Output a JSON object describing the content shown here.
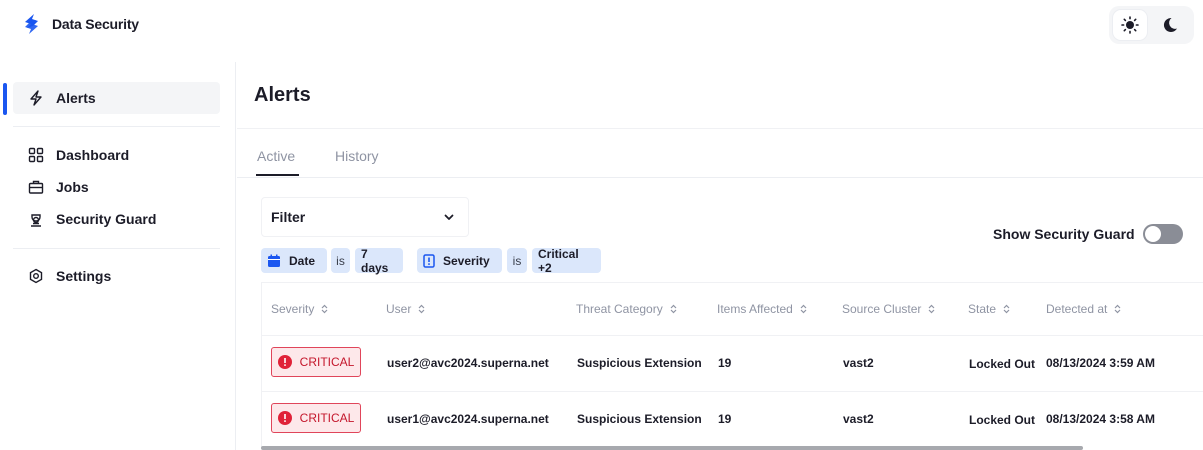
{
  "app": {
    "name": "Data Security"
  },
  "sidebar": {
    "items": [
      {
        "label": "Alerts",
        "icon": "bolt-icon",
        "active": true
      },
      {
        "label": "Dashboard",
        "icon": "grid-icon"
      },
      {
        "label": "Jobs",
        "icon": "briefcase-icon"
      },
      {
        "label": "Security Guard",
        "icon": "guard-icon"
      },
      {
        "label": "Settings",
        "icon": "gear-icon"
      }
    ]
  },
  "page": {
    "title": "Alerts"
  },
  "tabs": [
    {
      "label": "Active",
      "active": true
    },
    {
      "label": "History"
    }
  ],
  "filter": {
    "label": "Filter",
    "chips": [
      {
        "field": "Date",
        "op": "is",
        "value": "7 days",
        "icon": "calendar-icon"
      },
      {
        "field": "Severity",
        "op": "is",
        "value": "Critical +2",
        "icon": "alert-square-icon"
      }
    ]
  },
  "show_guard": {
    "label": "Show Security Guard",
    "on": false
  },
  "table": {
    "columns": [
      "Severity",
      "User",
      "Threat Category",
      "Items Affected",
      "Source Cluster",
      "State",
      "Detected at"
    ],
    "rows": [
      {
        "severity": "CRITICAL",
        "user": "user2@avc2024.superna.net",
        "category": "Suspicious Extension",
        "items": "19",
        "cluster": "vast2",
        "state": "Locked Out",
        "detected": "08/13/2024 3:59 AM"
      },
      {
        "severity": "CRITICAL",
        "user": "user1@avc2024.superna.net",
        "category": "Suspicious Extension",
        "items": "19",
        "cluster": "vast2",
        "state": "Locked Out",
        "detected": "08/13/2024 3:58 AM"
      }
    ]
  },
  "colors": {
    "accent": "#1a56f0",
    "critical": "#e02238",
    "chip_bg": "#dbe7fb"
  }
}
